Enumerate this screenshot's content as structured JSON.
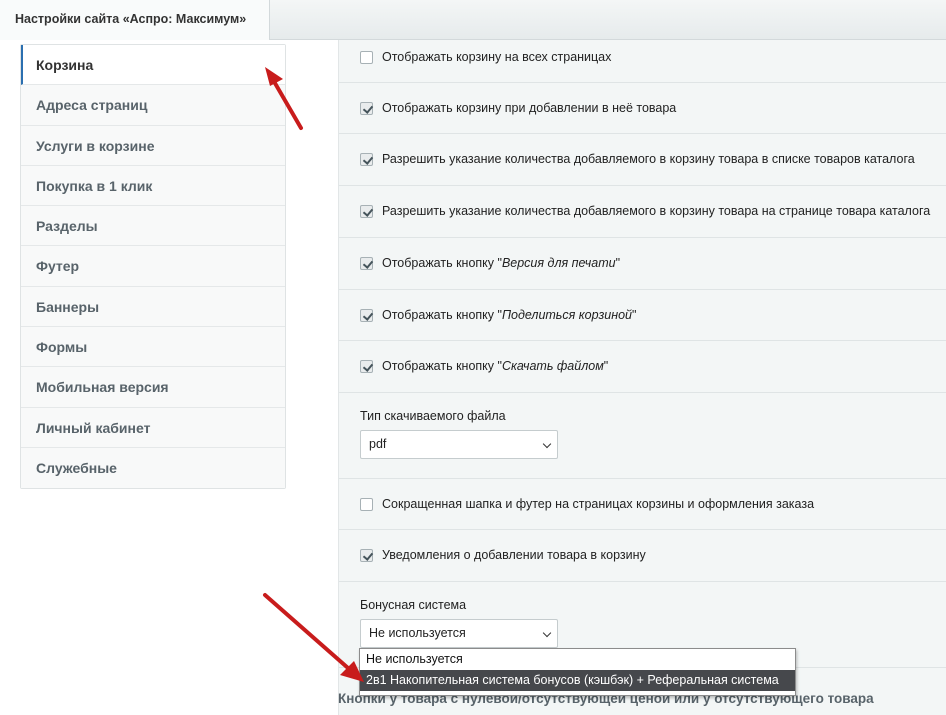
{
  "window": {
    "tab_title": "Настройки сайта «Аспро: Максимум» (s1)"
  },
  "sidebar": {
    "items": [
      {
        "label": "Корзина",
        "active": true
      },
      {
        "label": "Адреса страниц"
      },
      {
        "label": "Услуги в корзине"
      },
      {
        "label": "Покупка в 1 клик"
      },
      {
        "label": "Разделы"
      },
      {
        "label": "Футер"
      },
      {
        "label": "Баннеры"
      },
      {
        "label": "Формы"
      },
      {
        "label": "Мобильная версия"
      },
      {
        "label": "Личный кабинет"
      },
      {
        "label": "Служебные"
      }
    ]
  },
  "settings": {
    "opt1": {
      "label": "Отображать корзину на всех страницах",
      "checked": false
    },
    "opt2": {
      "label": "Отображать корзину при добавлении в неё товара",
      "checked": true
    },
    "opt3": {
      "label": "Разрешить указание количества добавляемого в корзину товара в списке товаров каталога",
      "checked": true
    },
    "opt4": {
      "label": "Разрешить указание количества добавляемого в корзину товара на странице товара каталога",
      "checked": true
    },
    "opt5": {
      "prefix": "Отображать кнопку \"",
      "name": "Версия для печати",
      "suffix": "\"",
      "checked": true
    },
    "opt6": {
      "prefix": "Отображать кнопку \"",
      "name": "Поделиться корзиной",
      "suffix": "\"",
      "checked": true
    },
    "opt7": {
      "prefix": "Отображать кнопку \"",
      "name": "Скачать файлом",
      "suffix": "\"",
      "checked": true
    },
    "file_type": {
      "title": "Тип скачиваемого файла",
      "value": "pdf"
    },
    "opt8": {
      "label": "Сокращенная шапка и футер на страницах корзины и оформления заказа",
      "checked": false
    },
    "opt9": {
      "label": "Уведомления о добавлении товара в корзину",
      "checked": true
    },
    "bonus": {
      "title": "Бонусная система",
      "value": "Не используется",
      "options": [
        "Не используется",
        "2в1 Накопительная система бонусов (кэшбэк) + Реферальная система"
      ],
      "hovered_index": 1
    }
  },
  "next_section_title": "Кнопки у товара с нулевой/отсутствующей ценой или у отсутствующего товара",
  "colors": {
    "arrow": "#c81c1c",
    "active_border": "#2b6fb0",
    "dropdown_hover": "#46484c"
  }
}
